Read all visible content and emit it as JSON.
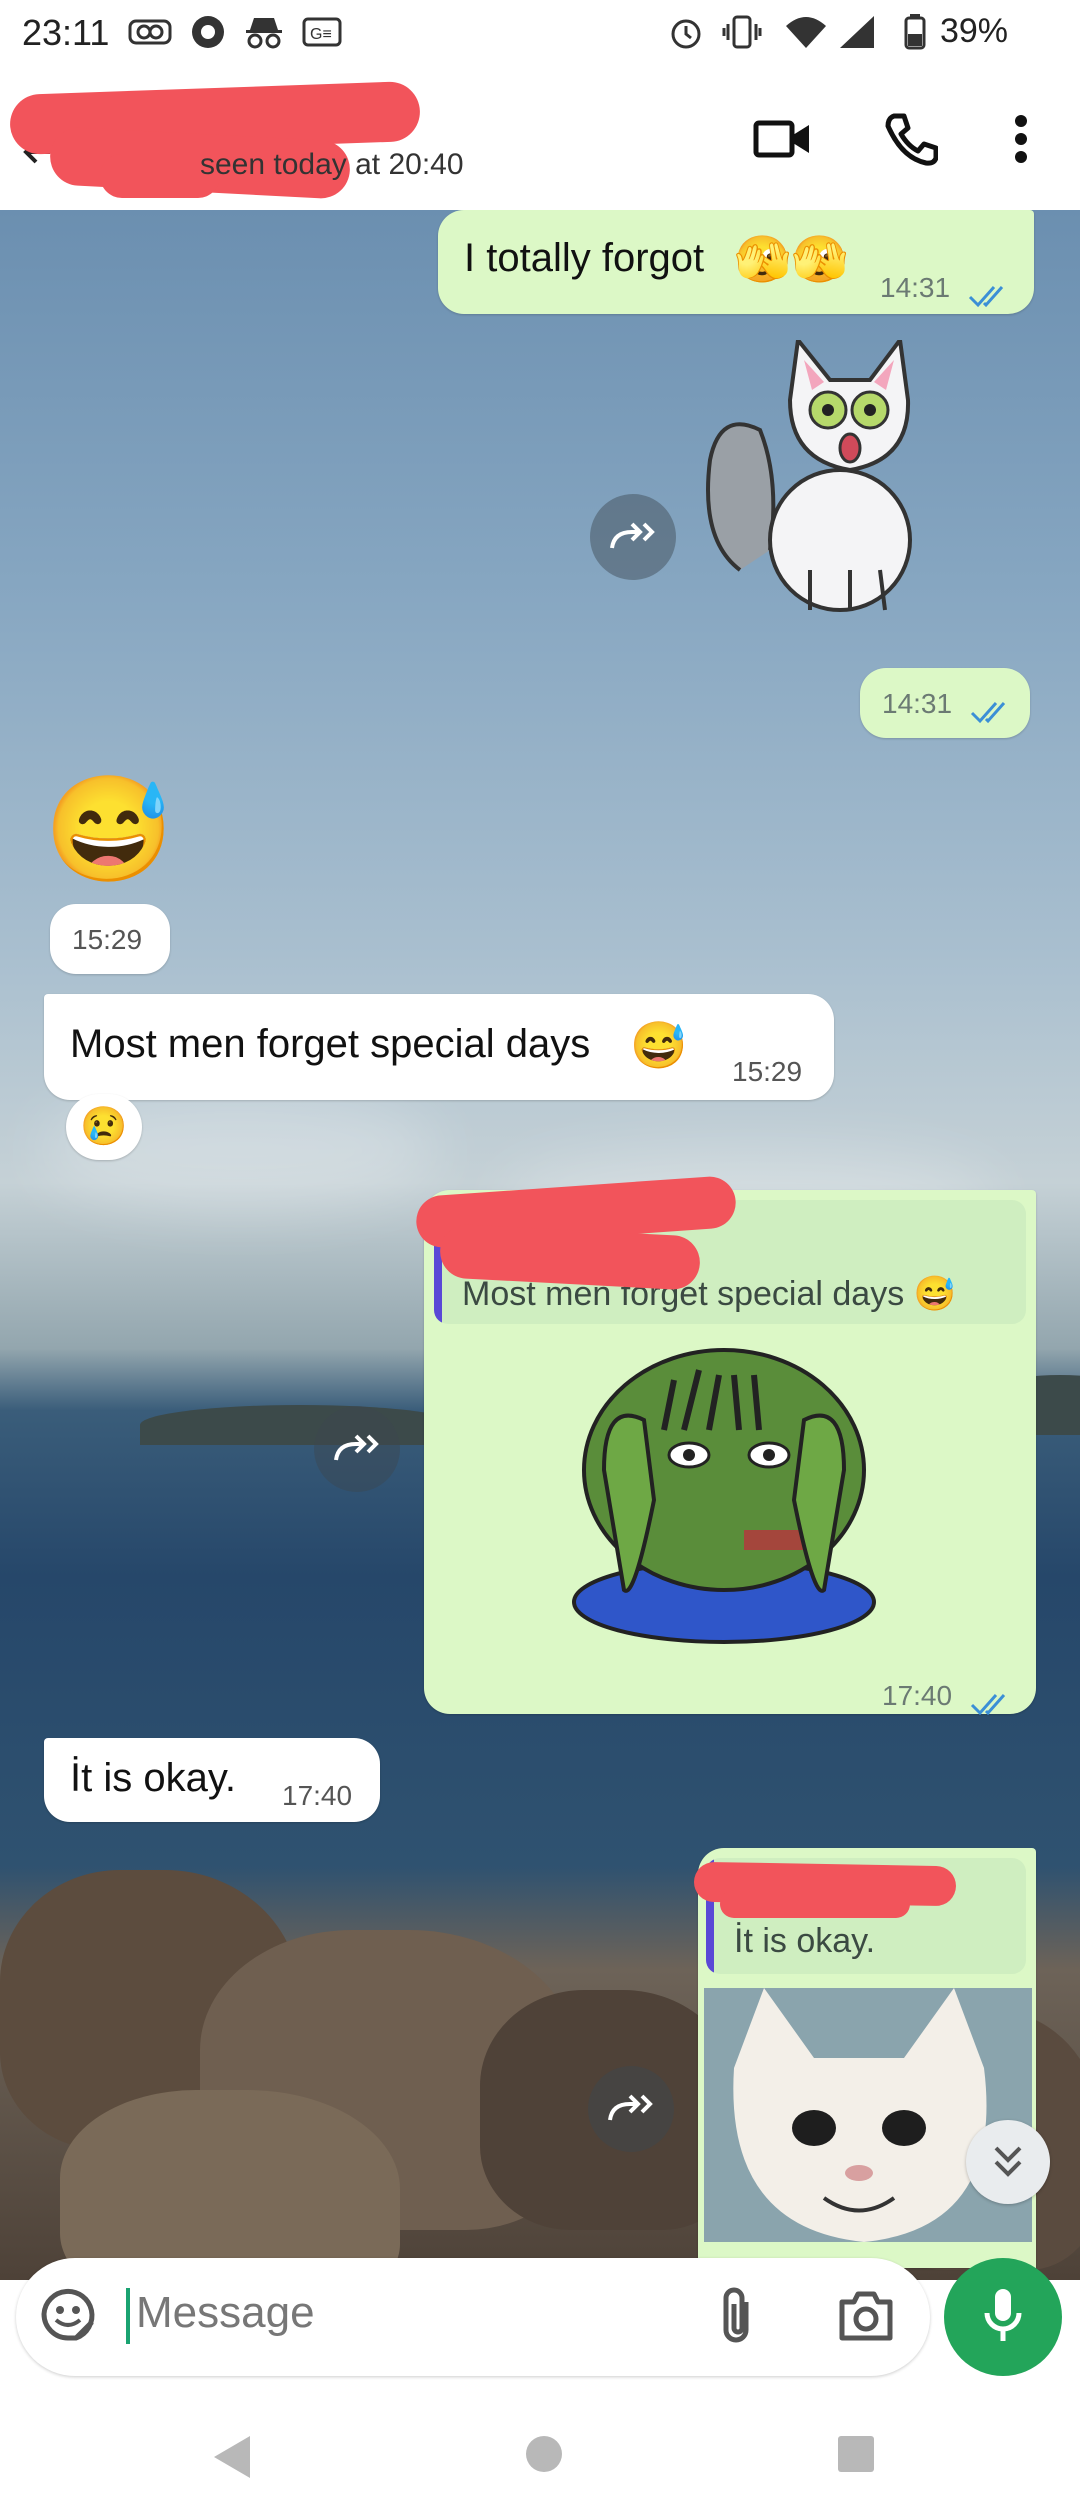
{
  "status_bar": {
    "time": "23:11",
    "battery": "39%",
    "icons": [
      "infinity-icon",
      "vpn-icon",
      "incognito-icon",
      "ge-icon",
      "alarm-icon",
      "vibrate-icon",
      "wifi-icon",
      "signal-icon",
      "battery-icon"
    ]
  },
  "header": {
    "last_seen": "seen today at 20:40",
    "icons": [
      "back-arrow-icon",
      "video-call-icon",
      "phone-icon",
      "more-vert-icon"
    ]
  },
  "messages": [
    {
      "direction": "out",
      "type": "text",
      "text": "I totally forgot",
      "emoji": "🫣🫣",
      "time": "14:31",
      "status": "read"
    },
    {
      "direction": "out",
      "type": "sticker",
      "sticker": "surprised-cat-sticker",
      "time": "14:31",
      "status": "read"
    },
    {
      "direction": "in",
      "type": "emoji",
      "emoji": "😅",
      "time": "15:29"
    },
    {
      "direction": "in",
      "type": "text",
      "text": "Most men forget special days",
      "emoji": "😅",
      "time": "15:29",
      "reaction": "😢"
    },
    {
      "direction": "out",
      "type": "reply-sticker",
      "quoted_text": "Most men forget special days",
      "quoted_emoji": "😅",
      "sticker": "pepe-hiding-face-sticker",
      "time": "17:40",
      "status": "read"
    },
    {
      "direction": "in",
      "type": "text",
      "text": "İt is okay.",
      "time": "17:40"
    },
    {
      "direction": "out",
      "type": "reply-image",
      "quoted_text": "İt is okay.",
      "image": "cat-smiling-photo"
    }
  ],
  "composer": {
    "placeholder": "Message",
    "icons": [
      "sticker-icon",
      "attach-icon",
      "camera-icon",
      "mic-icon"
    ]
  },
  "colors": {
    "outgoing_bubble": "#dcf8c6",
    "incoming_bubble": "#ffffff",
    "read_ticks": "#3b8fd6",
    "mic_button": "#23a55a",
    "reply_bar": "#5a48d6",
    "redaction": "#f2545b"
  },
  "navbar": {
    "icons": [
      "back-nav-icon",
      "home-nav-icon",
      "recents-nav-icon"
    ]
  }
}
